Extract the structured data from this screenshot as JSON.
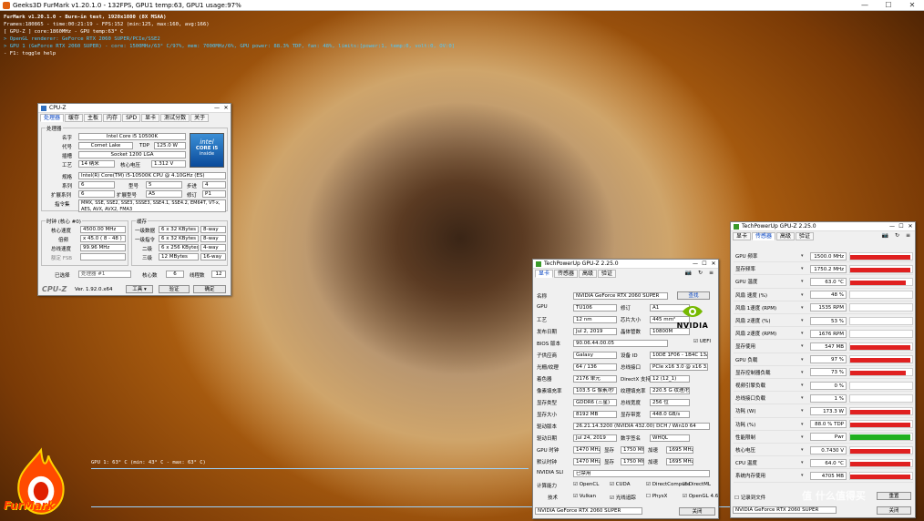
{
  "app": {
    "title": "Geeks3D FurMark v1.20.1.0 - 132FPS, GPU1 temp:63, GPU1 usage:97%",
    "logo_text": "FurMark"
  },
  "hud": {
    "l1": "FurMark v1.20.1.0 - Burn-in test, 1920x1080 (8X MSAA)",
    "l2": "Frames:180865 - time:00:21:19 - FPS:152 (min:125, max:160, avg:166)",
    "l3": "[ GPU-Z ] core:1860MHz - GPU temp:63° C",
    "l4": "> OpenGL renderer: GeForce RTX 2060 SUPER/PCIe/SSE2",
    "l5": "> GPU 1 (GeForce RTX 2060 SUPER) - core: 1500MHz/63° C/97%, mem: 7000MHz/6%, GPU power: 88.3% TDP, fan: 48%, limits:[power:1, temp:0, volt:0, OV:0]",
    "l6": "- F1: toggle help",
    "gpu_graph": "GPU 1: 63° C (min: 43° C - max: 63° C)"
  },
  "cpuz": {
    "title": "CPU-Z",
    "tabs": [
      "处理器",
      "缓存",
      "主板",
      "内存",
      "SPD",
      "显卡",
      "测试分数",
      "关于"
    ],
    "proc_group": "处理器",
    "name_l": "名字",
    "name_v": "Intel Core i5 10500K",
    "code_l": "代号",
    "code_v": "Comet Lake",
    "tdp_l": "TDP",
    "tdp_v": "125.0 W",
    "pkg_l": "插槽",
    "pkg_v": "Socket 1200 LGA",
    "tech_l": "工艺",
    "tech_v": "14 纳米",
    "volt_l": "核心电压",
    "volt_v": "1.312 V",
    "spec_l": "规格",
    "spec_v": "Intel(R) Core(TM) i5-10500K CPU @ 4.10GHz (ES)",
    "fam_l": "系列",
    "fam_v": "6",
    "model_l": "型号",
    "model_v": "5",
    "step_l": "步进",
    "step_v": "4",
    "efam_l": "扩展系列",
    "efam_v": "6",
    "emodel_l": "扩展型号",
    "emodel_v": "A5",
    "rev_l": "修订",
    "rev_v": "P1",
    "inst_l": "指令集",
    "inst_v": "MMX, SSE, SSE2, SSE3, SSSE3, SSE4.1, SSE4.2, EM64T, VT-x, AES, AVX, AVX2, FMA3",
    "clk_group": "时钟 (核心 #0)",
    "cs_l": "核心速度",
    "cs_v": "4500.00 MHz",
    "mult_l": "倍频",
    "mult_v": "x 45.0 ( 8 - 48 )",
    "bus_l": "总线速度",
    "bus_v": "99.96 MHz",
    "fsb_l": "额定 FSB",
    "fsb_v": "",
    "cache_group": "缓存",
    "l1d_l": "一级数据",
    "l1d_v": "6 x 32 KBytes",
    "l1d_w": "8-way",
    "l1i_l": "一级指令",
    "l1i_v": "6 x 32 KBytes",
    "l1i_w": "8-way",
    "l2_l": "二级",
    "l2_v": "6 x 256 KBytes",
    "l2_w": "4-way",
    "l3_l": "三级",
    "l3_v": "12 MBytes",
    "l3_w": "16-way",
    "sel_l": "已选择",
    "sel_v": "处理器 #1",
    "cores_l": "核心数",
    "cores_v": "6",
    "thr_l": "线程数",
    "thr_v": "12",
    "brand": "CPU-Z",
    "ver": "Ver. 1.92.0.x64",
    "tools": "工具",
    "verify": "验证",
    "ok": "确定",
    "intel_t1": "intel",
    "intel_t2": "CORE i5",
    "intel_t3": "inside"
  },
  "gpuz": {
    "title": "TechPowerUp GPU-Z 2.25.0",
    "tabs": [
      "显卡",
      "传感器",
      "高级",
      "验证"
    ],
    "rows": [
      {
        "l": "名称",
        "v": "NVIDIA GeForce RTX 2060 SUPER"
      },
      {
        "l": "GPU",
        "v": "TU106",
        "l2": "修订",
        "v2": "A1"
      },
      {
        "l": "工艺",
        "v": "12 nm",
        "l2": "芯片大小",
        "v2": "445 mm²"
      },
      {
        "l": "发布日期",
        "v": "Jul 2, 2019",
        "l2": "晶体管数",
        "v2": "10800M"
      },
      {
        "l": "BIOS 版本",
        "v": "90.06.44.00.05"
      },
      {
        "l": "子供应商",
        "v": "Galaxy",
        "l2": "设备 ID",
        "v2": "10DE 1F06 - 1B4C 13A3"
      },
      {
        "l": "光栅/纹理",
        "v": "64 / 136",
        "l2": "总线接口",
        "v2": "PCIe x16 3.0 @ x16 3.0"
      },
      {
        "l": "着色器",
        "v": "2176 单元",
        "l2": "DirectX 支持",
        "v2": "12 (12_1)"
      },
      {
        "l": "像素填充率",
        "v": "103.5 G 像素/秒",
        "l2": "纹理填充率",
        "v2": "220.5 G 纹理/秒"
      },
      {
        "l": "显存类型",
        "v": "GDDR6 (三星)",
        "l2": "总线宽度",
        "v2": "256 位"
      },
      {
        "l": "显存大小",
        "v": "8192 MB",
        "l2": "显存带宽",
        "v2": "448.0 GB/s"
      },
      {
        "l": "驱动版本",
        "v": "26.21.14.3200 (NVIDIA 432.00) DCH / Win10 64"
      },
      {
        "l": "驱动日期",
        "v": "Jul 24, 2019",
        "l2": "数字签名",
        "v2": "WHQL"
      },
      {
        "l": "GPU 时钟",
        "v": "1470 MHz",
        "l2": "显存",
        "v2": "1750 MHz",
        "l3": "加速",
        "v3": "1695 MHz"
      },
      {
        "l": "默认时钟",
        "v": "1470 MHz",
        "l2": "显存",
        "v2": "1750 MHz",
        "l3": "加速",
        "v3": "1695 MHz"
      },
      {
        "l": "NVIDIA SLI",
        "v": "已禁用"
      }
    ],
    "lookup": "查找",
    "uefi": "UEFI",
    "compute_l": "计算能力",
    "compute": [
      "OpenCL",
      "CUDA",
      "DirectCompute",
      "DirectML"
    ],
    "tech_l": "技术",
    "tech": [
      "Vulkan",
      "光线追踪",
      "PhysX",
      "OpenGL 4.6"
    ],
    "select": "NVIDIA GeForce RTX 2060 SUPER",
    "close": "关闭",
    "nvidia": "NVIDIA"
  },
  "gpuz2": {
    "title": "TechPowerUp GPU-Z 2.25.0",
    "tabs": [
      "显卡",
      "传感器",
      "高级",
      "验证"
    ],
    "sensors": [
      {
        "n": "GPU 频率",
        "v": "1500.0 MHz",
        "p": 0.97
      },
      {
        "n": "显存频率",
        "v": "1750.2 MHz",
        "p": 0.97
      },
      {
        "n": "GPU 温度",
        "v": "63.0 °C",
        "p": 0.9
      },
      {
        "n": "风扇 速度 (%)",
        "v": "48 %",
        "p": 0.0
      },
      {
        "n": "风扇 1速度 (RPM)",
        "v": "1535 RPM",
        "p": 0.0
      },
      {
        "n": "风扇 2速度 (%)",
        "v": "53 %",
        "p": 0.0
      },
      {
        "n": "风扇 2速度 (RPM)",
        "v": "1676 RPM",
        "p": 0.0
      },
      {
        "n": "显存使用",
        "v": "547 MB",
        "p": 0.97
      },
      {
        "n": "GPU 负载",
        "v": "97 %",
        "p": 0.97
      },
      {
        "n": "显存控制器负载",
        "v": "73 %",
        "p": 0.9
      },
      {
        "n": "视频引擎负载",
        "v": "0 %",
        "p": 0.0
      },
      {
        "n": "总线接口负载",
        "v": "1 %",
        "p": 0.0
      },
      {
        "n": "功耗 (W)",
        "v": "173.3 W",
        "p": 0.97
      },
      {
        "n": "功耗 (%)",
        "v": "88.0 % TDP",
        "p": 0.97
      },
      {
        "n": "性能限制",
        "v": "Pwr",
        "p": 0.97,
        "green": true
      },
      {
        "n": "核心电压",
        "v": "0.7430 V",
        "p": 0.97
      },
      {
        "n": "CPU 温度",
        "v": "64.0 °C",
        "p": 0.97
      },
      {
        "n": "系统内存使用",
        "v": "4705 MB",
        "p": 0.97
      }
    ],
    "log": "记录到文件",
    "reset": "重置",
    "select": "NVIDIA GeForce RTX 2060 SUPER",
    "close": "关闭"
  },
  "watermark": "值 什么值得买"
}
